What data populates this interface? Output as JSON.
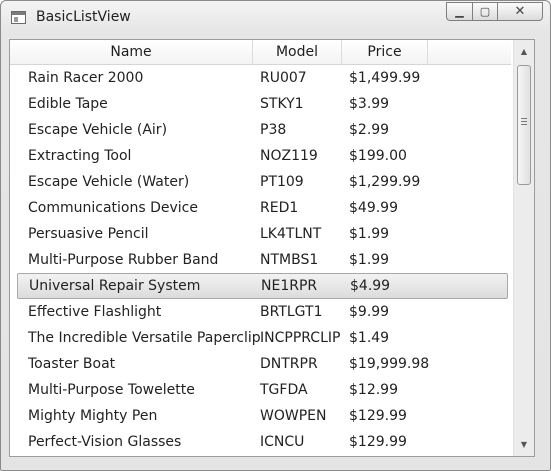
{
  "window": {
    "title": "BasicListView",
    "icon": "app-window-icon",
    "controls": {
      "minimize": "▁",
      "maximize": "▢",
      "close": "✕"
    }
  },
  "listview": {
    "columns": [
      "Name",
      "Model",
      "Price"
    ],
    "selected_index": 8,
    "rows": [
      {
        "name": "Rain Racer 2000",
        "model": "RU007",
        "price": "$1,499.99"
      },
      {
        "name": "Edible Tape",
        "model": "STKY1",
        "price": "$3.99"
      },
      {
        "name": "Escape Vehicle (Air)",
        "model": "P38",
        "price": "$2.99"
      },
      {
        "name": "Extracting Tool",
        "model": "NOZ119",
        "price": "$199.00"
      },
      {
        "name": "Escape Vehicle (Water)",
        "model": "PT109",
        "price": "$1,299.99"
      },
      {
        "name": "Communications Device",
        "model": "RED1",
        "price": "$49.99"
      },
      {
        "name": "Persuasive Pencil",
        "model": "LK4TLNT",
        "price": "$1.99"
      },
      {
        "name": "Multi-Purpose Rubber Band",
        "model": "NTMBS1",
        "price": "$1.99"
      },
      {
        "name": "Universal Repair System",
        "model": "NE1RPR",
        "price": "$4.99"
      },
      {
        "name": "Effective Flashlight",
        "model": "BRTLGT1",
        "price": "$9.99"
      },
      {
        "name": "The Incredible Versatile Paperclip",
        "model": "INCPPRCLIP",
        "price": "$1.49"
      },
      {
        "name": "Toaster Boat",
        "model": "DNTRPR",
        "price": "$19,999.98"
      },
      {
        "name": "Multi-Purpose Towelette",
        "model": "TGFDA",
        "price": "$12.99"
      },
      {
        "name": "Mighty Mighty Pen",
        "model": "WOWPEN",
        "price": "$129.99"
      },
      {
        "name": "Perfect-Vision Glasses",
        "model": "ICNCU",
        "price": "$129.99"
      }
    ]
  },
  "scrollbar": {
    "up_arrow": "▲",
    "down_arrow": "▼"
  }
}
